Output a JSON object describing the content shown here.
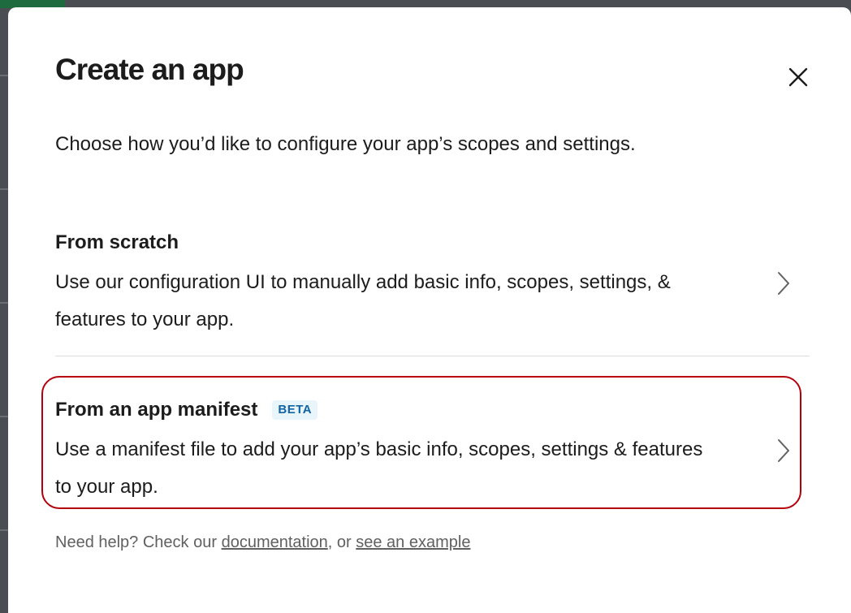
{
  "modal": {
    "title": "Create an app",
    "subtitle": "Choose how you’d like to configure your app’s scopes and settings.",
    "close_icon": "close-icon"
  },
  "options": [
    {
      "title": "From scratch",
      "description": "Use our configuration UI to manually add basic info, scopes, settings, & features to your app.",
      "icon": "chevron-right-icon"
    },
    {
      "title": "From an app manifest",
      "badge": "BETA",
      "description": "Use a manifest file to add your app’s basic info, scopes, settings & features to your app.",
      "icon": "chevron-right-icon"
    }
  ],
  "help": {
    "prefix": "Need help? Check our ",
    "documentation_link": "documentation",
    "middle": ", or ",
    "example_link": "see an example"
  },
  "colors": {
    "highlight_border": "#b3000b",
    "badge_text": "#1264a3",
    "badge_bg": "#e8f5fa",
    "text": "#1d1c1d",
    "muted_text": "#616061",
    "divider": "#dddddd"
  }
}
